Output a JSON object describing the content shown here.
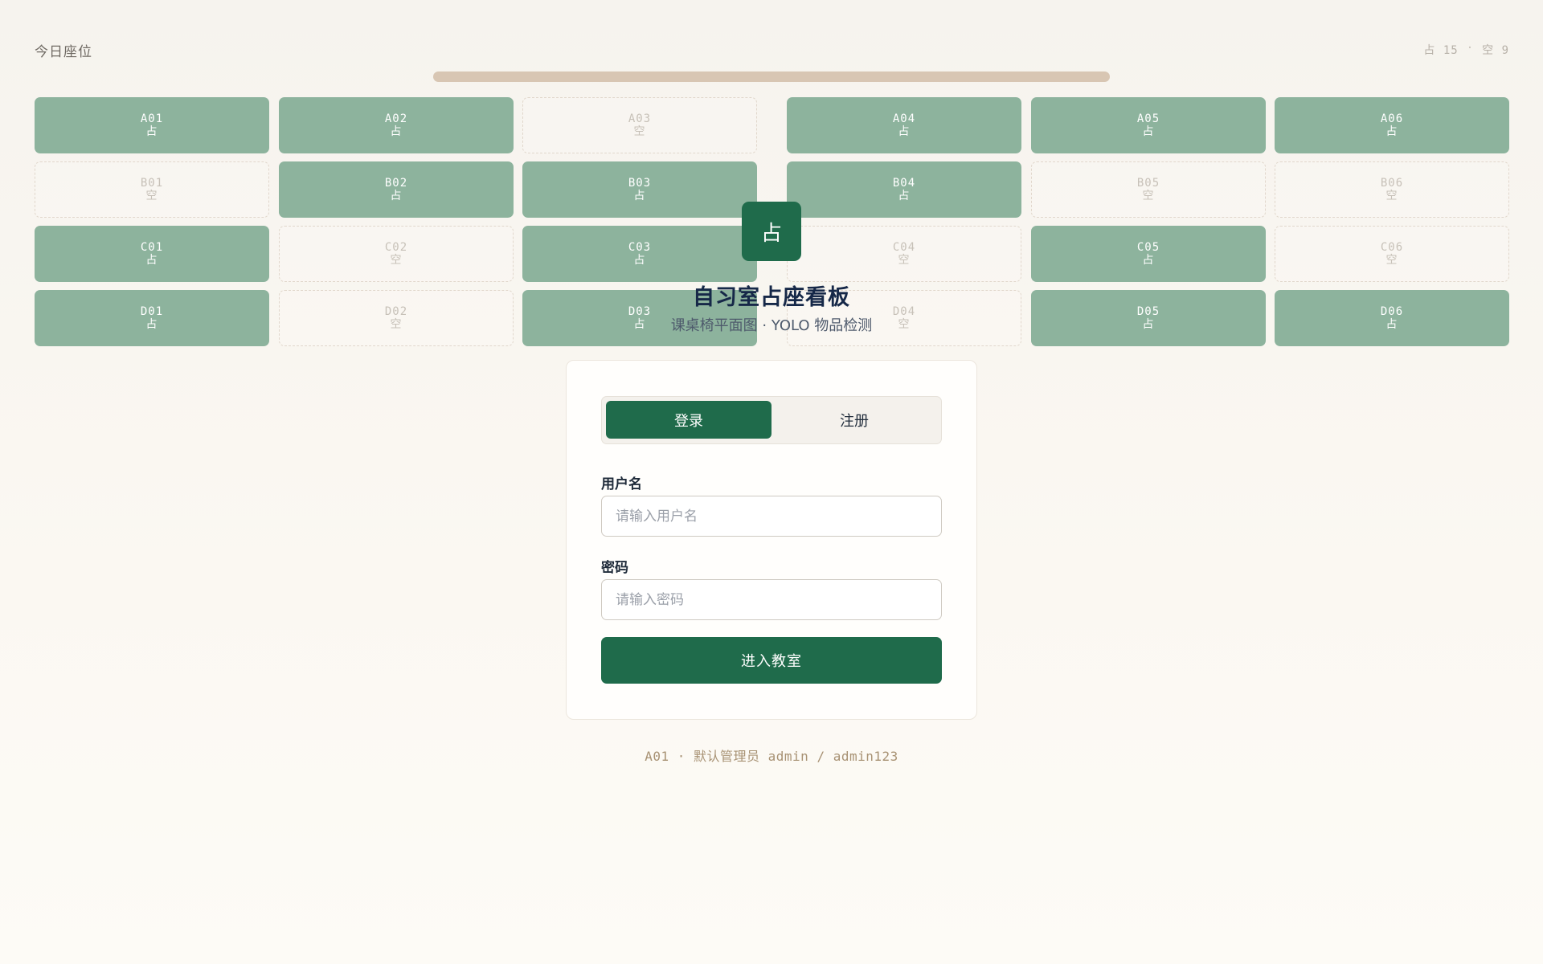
{
  "board": {
    "title": "今日座位",
    "stats": {
      "occupied": "占 15",
      "dot": "·",
      "empty": "空 9"
    },
    "seats": [
      [
        {
          "id": "A01",
          "status": "占"
        },
        {
          "id": "A02",
          "status": "占"
        },
        {
          "id": "A03",
          "status": "空"
        },
        {
          "id": "A04",
          "status": "占"
        },
        {
          "id": "A05",
          "status": "占"
        },
        {
          "id": "A06",
          "status": "占"
        }
      ],
      [
        {
          "id": "B01",
          "status": "空"
        },
        {
          "id": "B02",
          "status": "占"
        },
        {
          "id": "B03",
          "status": "占"
        },
        {
          "id": "B04",
          "status": "占"
        },
        {
          "id": "B05",
          "status": "空"
        },
        {
          "id": "B06",
          "status": "空"
        }
      ],
      [
        {
          "id": "C01",
          "status": "占"
        },
        {
          "id": "C02",
          "status": "空"
        },
        {
          "id": "C03",
          "status": "占"
        },
        {
          "id": "C04",
          "status": "空"
        },
        {
          "id": "C05",
          "status": "占"
        },
        {
          "id": "C06",
          "status": "空"
        }
      ],
      [
        {
          "id": "D01",
          "status": "占"
        },
        {
          "id": "D02",
          "status": "空"
        },
        {
          "id": "D03",
          "status": "占"
        },
        {
          "id": "D04",
          "status": "空"
        },
        {
          "id": "D05",
          "status": "占"
        },
        {
          "id": "D06",
          "status": "占"
        }
      ]
    ]
  },
  "brand": {
    "logo_char": "占",
    "title": "自习室占座看板",
    "subtitle": "课桌椅平面图 · YOLO 物品检测"
  },
  "auth": {
    "tabs": {
      "login": "登录",
      "register": "注册"
    },
    "username": {
      "label": "用户名",
      "placeholder": "请输入用户名",
      "value": ""
    },
    "password": {
      "label": "密码",
      "placeholder": "请输入密码",
      "value": ""
    },
    "submit_label": "进入教室",
    "hint": "A01 · 默认管理员 admin / admin123"
  },
  "colors": {
    "accent": "#1f6b4b",
    "seat_occupied": "#8db39d",
    "podium": "#d8c6b3",
    "background": "#f6f3ee"
  }
}
